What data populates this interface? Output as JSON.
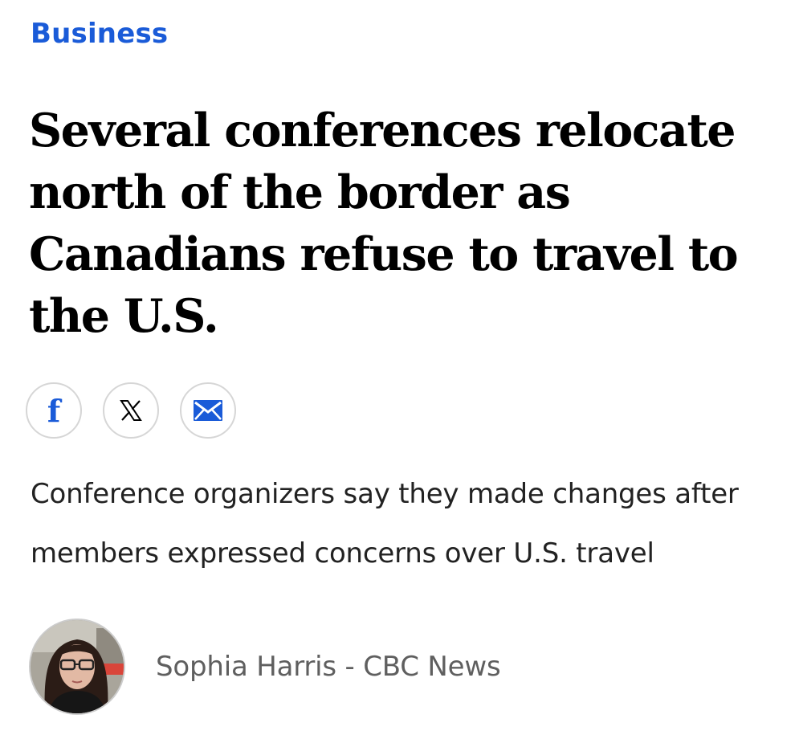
{
  "article": {
    "category": "Business",
    "headline": "Several conferences relocate north of the border as Canadians refuse to travel to the U.S.",
    "subheadline": "Conference organizers say they made changes after members expressed concerns over U.S. travel",
    "author": "Sophia Harris - CBC News"
  },
  "share": {
    "facebook_glyph": "f",
    "buttons": [
      "facebook-icon",
      "x-icon",
      "mail-icon"
    ]
  },
  "colors": {
    "accent": "#1a5bd8",
    "text": "#000000",
    "byline": "#5f5f5f",
    "button_border": "#d6d6d6"
  }
}
